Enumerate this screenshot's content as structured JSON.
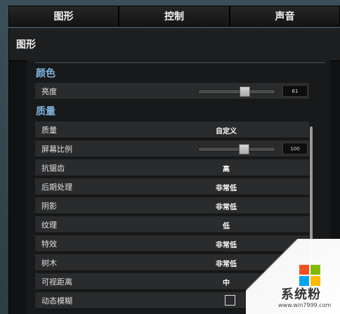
{
  "tabs": [
    {
      "label": "图形"
    },
    {
      "label": "控制"
    },
    {
      "label": "声音"
    }
  ],
  "panel": {
    "title": "图形",
    "sections": {
      "color": {
        "title": "颜色"
      },
      "quality": {
        "title": "质量"
      }
    },
    "color_rows": [
      {
        "label": "亮度",
        "value": "61",
        "slider_fraction": 0.61
      }
    ],
    "quality_rows": [
      {
        "label": "质量",
        "value": "自定义"
      },
      {
        "label": "屏幕比例",
        "value": "100",
        "slider_fraction": 0.6
      },
      {
        "label": "抗锯齿",
        "value": "高"
      },
      {
        "label": "后期处理",
        "value": "非常低"
      },
      {
        "label": "阴影",
        "value": "非常低"
      },
      {
        "label": "纹理",
        "value": "低"
      },
      {
        "label": "特效",
        "value": "非常低"
      },
      {
        "label": "树木",
        "value": "非常低"
      },
      {
        "label": "可视距离",
        "value": "中"
      },
      {
        "label": "动态模糊",
        "checked": false
      }
    ]
  },
  "watermark": {
    "text": "系统粉",
    "url": "www.win7999.com"
  }
}
